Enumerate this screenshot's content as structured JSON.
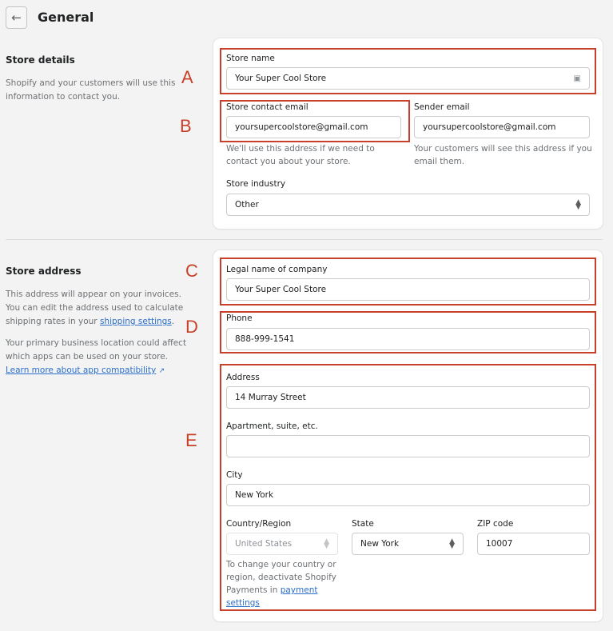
{
  "header": {
    "title": "General"
  },
  "store_details": {
    "title": "Store details",
    "description": "Shopify and your customers will use this information to contact you.",
    "store_name": {
      "label": "Store name",
      "value": "Your Super Cool Store"
    },
    "contact_email": {
      "label": "Store contact email",
      "value": "yoursupercoolstore@gmail.com",
      "help": "We'll use this address if we need to contact you about your store."
    },
    "sender_email": {
      "label": "Sender email",
      "value": "yoursupercoolstore@gmail.com",
      "help": "Your customers will see this address if you email them."
    },
    "industry": {
      "label": "Store industry",
      "value": "Other"
    }
  },
  "store_address": {
    "title": "Store address",
    "desc1": "This address will appear on your invoices. You can edit the address used to calculate shipping rates in your ",
    "desc1_link": "shipping settings",
    "desc1_end": ".",
    "desc2": "Your primary business location could affect which apps can be used on your store. ",
    "desc2_link": "Learn more about app compatibility",
    "legal_name": {
      "label": "Legal name of company",
      "value": "Your Super Cool Store"
    },
    "phone": {
      "label": "Phone",
      "value": "888-999-1541"
    },
    "address": {
      "label": "Address",
      "value": "14 Murray Street"
    },
    "apartment": {
      "label": "Apartment, suite, etc.",
      "value": ""
    },
    "city": {
      "label": "City",
      "value": "New York"
    },
    "country": {
      "label": "Country/Region",
      "value": "United States",
      "help": "To change your country or region, deactivate Shopify Payments in ",
      "help_link": "payment settings"
    },
    "state": {
      "label": "State",
      "value": "New York"
    },
    "zip": {
      "label": "ZIP code",
      "value": "10007"
    }
  },
  "annotations": {
    "a": "A",
    "b": "B",
    "c": "C",
    "d": "D",
    "e": "E",
    "color": "#c8402a"
  }
}
